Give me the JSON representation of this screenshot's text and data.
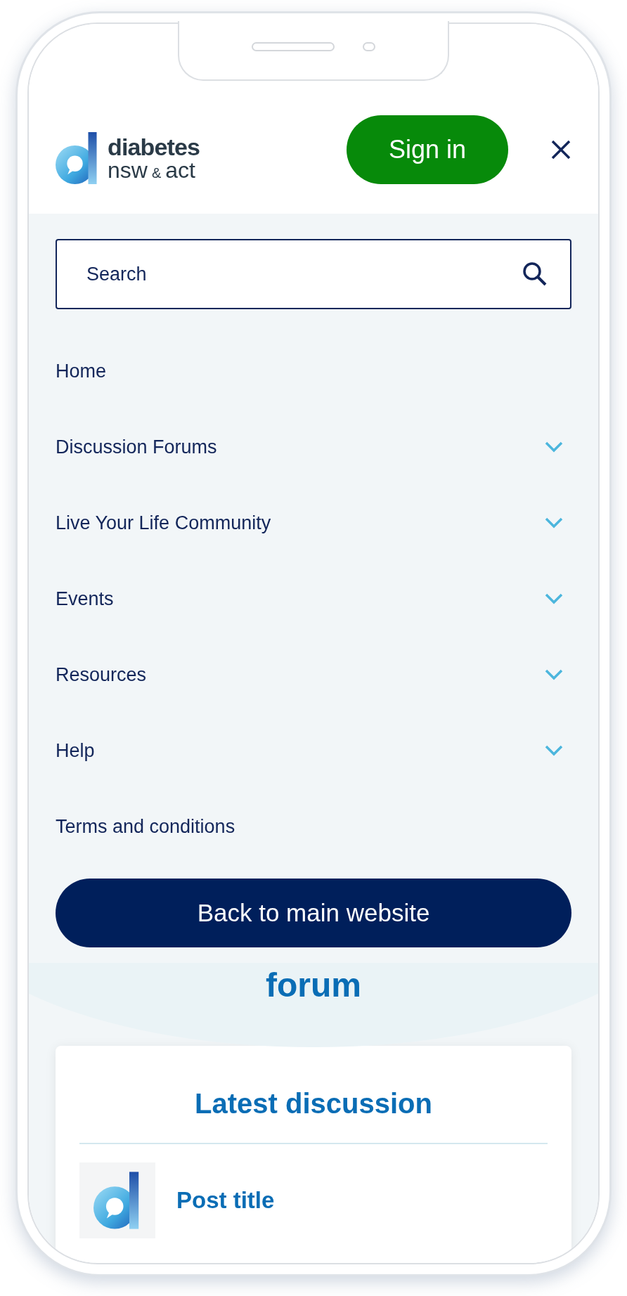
{
  "header": {
    "logo": {
      "line1": "diabetes",
      "line2_a": "nsw",
      "line2_amp": "&",
      "line2_b": "act"
    },
    "sign_in": "Sign in"
  },
  "search": {
    "placeholder": "Search"
  },
  "menu": [
    {
      "label": "Home",
      "expandable": false
    },
    {
      "label": "Discussion Forums",
      "expandable": true
    },
    {
      "label": "Live Your Life Community",
      "expandable": true
    },
    {
      "label": "Events",
      "expandable": true
    },
    {
      "label": "Resources",
      "expandable": true
    },
    {
      "label": "Help",
      "expandable": true
    },
    {
      "label": "Terms and conditions",
      "expandable": false
    }
  ],
  "back_button": "Back to main website",
  "hero": {
    "title": "forum"
  },
  "latest": {
    "title": "Latest discussion",
    "posts": [
      {
        "title": "Post title"
      }
    ]
  }
}
